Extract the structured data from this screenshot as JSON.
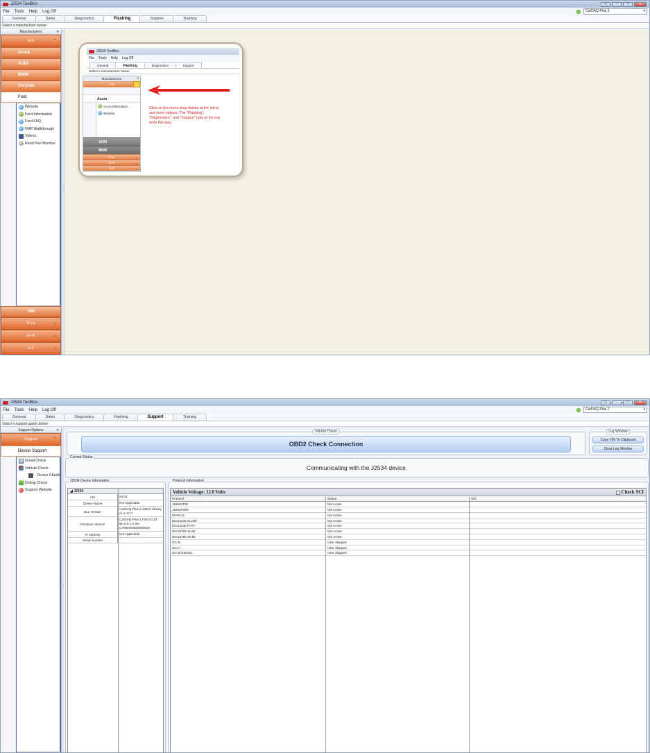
{
  "common": {
    "title": "J2534 ToolBox",
    "menu": [
      "File",
      "Tools",
      "Help",
      "Log Off"
    ],
    "window_buttons": [
      "▭",
      "–",
      "□",
      "✕"
    ],
    "tabs": [
      "General",
      "Sales",
      "Diagnostics",
      "Flashing",
      "Support",
      "Training"
    ]
  },
  "flashing_window": {
    "active_tab": "Flashing",
    "device": "CarDAQ-Plus 2",
    "hint": "Select a manufacturer below:",
    "sidebar_header": "Manufacturers",
    "group_top": "A-G",
    "manufacturers": [
      "Acura",
      "AUDI",
      "BMW",
      "Chrysler"
    ],
    "selected_manufacturer": "Ford",
    "ford_items": [
      {
        "label": "Website",
        "icon": "globe-icon"
      },
      {
        "label": "Ford Information",
        "icon": "info-icon"
      },
      {
        "label": "Ford FAQ",
        "icon": "globe-icon"
      },
      {
        "label": "FMP Walkthrough",
        "icon": "globe-icon"
      },
      {
        "label": "Videos",
        "icon": "video-icon"
      },
      {
        "label": "Read Part Number",
        "icon": "part-icon"
      }
    ],
    "gm": "GM",
    "groups_bottom": [
      "H-La",
      "Le-N",
      "S-Z"
    ],
    "tutorial": {
      "title": "J2534 ToolBox",
      "menu": [
        "File",
        "Tools",
        "Help",
        "Log Off"
      ],
      "tabs": [
        "General",
        "Flashing",
        "Diagnostics",
        "Support"
      ],
      "hint": "Select a manufacturer below:",
      "sidebar_header": "Manufacturers",
      "group": "A-G",
      "acura": "Acura",
      "acura_items": [
        "Acura Information",
        "Website"
      ],
      "mfrs": [
        "AUDI",
        "BMW"
      ],
      "groups": [
        "H-La",
        "Le-N",
        "S-Z"
      ],
      "note": "Click on the menu drop downs at the left to see more options. The \"Flashing\", \"Diagnostics\", and \"Support\" tabs at the top work this way."
    }
  },
  "support_window": {
    "active_tab": "Support",
    "device": "CarDAQ-Plus 2",
    "hint": "Select a support option below:",
    "sidebar_header": "Support Options",
    "group": "Support",
    "selected": "Device Support",
    "items": [
      {
        "label": "Install Check",
        "icon": "install-icon"
      },
      {
        "label": "Vehicle Check",
        "icon": "vehicle-icon"
      },
      {
        "label": "Device Check",
        "icon": "device-icon"
      },
      {
        "label": "Debug Check",
        "icon": "debug-icon"
      },
      {
        "label": "Support Website",
        "icon": "support-icon"
      }
    ],
    "vehicle_check_legend": "Vehicle Check",
    "obd_button": "OBD2 Check Connection",
    "log_legend": "Log Window",
    "copy_vin": "Copy VIN To Clipboard",
    "clear_log": "Clear Log Window",
    "current_status_legend": "Current Status",
    "status": "Communicating with the J2534 device.",
    "device_info_legend": "J2534 Device Information",
    "device_info_head": "◢ J2534",
    "device_info": [
      {
        "k": "API",
        "v": "04.04"
      },
      {
        "k": "Device Name",
        "v": "Not Applicable"
      },
      {
        "k": "DLL Version",
        "v": "CarDAQ-Plus 2 J2534 Library v1.1.17.0"
      },
      {
        "k": "Firmware Version",
        "v": "CarDAQ-Plus 2 FW:0.0.1/f BL:0.0.1.3 SN: CARBY0000000000A"
      },
      {
        "k": "IP Address",
        "v": "Not Applicable"
      },
      {
        "k": "Serial Number",
        "v": ""
      }
    ],
    "protocol_legend": "Protocol Information",
    "voltage": "Vehicle Voltage: 12.0 Volts",
    "check_sci": "Check SCI",
    "protocol_headers": [
      "Protocol",
      "Status",
      "VIN"
    ],
    "protocols": [
      {
        "p": "J1850VPW",
        "s": "Not Active"
      },
      {
        "p": "J1850PWM",
        "s": "Not Active"
      },
      {
        "p": "ISO9141",
        "s": "Not Active"
      },
      {
        "p": "ISO14230 SLOW",
        "s": "Not Active"
      },
      {
        "p": "ISO14230 FAST",
        "s": "Not Active"
      },
      {
        "p": "ISO15765 11 Bit",
        "s": "Not Active"
      },
      {
        "p": "ISO15765 29 Bit",
        "s": "Not Active"
      },
      {
        "p": "SCI B",
        "s": "User Skipped"
      },
      {
        "p": "SCI A",
        "s": "User Skipped"
      },
      {
        "p": "SCI B DIESEL",
        "s": "User Skipped"
      }
    ]
  },
  "colors": {
    "accent_orange": "#e06a2e",
    "selection_blue": "#4c6fa7",
    "note_red": "#d81e1e"
  }
}
